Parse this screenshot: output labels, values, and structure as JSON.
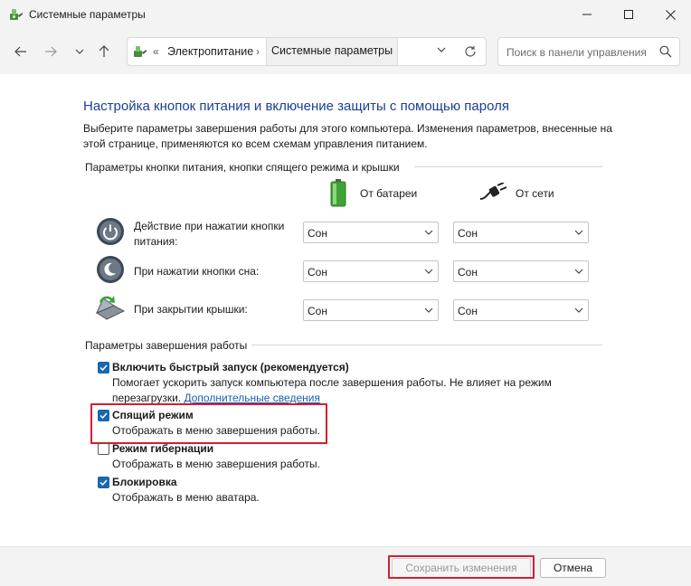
{
  "window": {
    "title": "Системные параметры",
    "app_icon": "power-options-icon",
    "controls": [
      "minimize-icon",
      "maximize-icon",
      "close-icon"
    ]
  },
  "nav": {
    "back_icon": "arrow-left-icon",
    "forward_icon": "arrow-right-icon",
    "history_icon": "chevron-down-icon",
    "up_icon": "arrow-up-icon",
    "breadcrumb": {
      "overflow": "«",
      "items": [
        "Электропитание",
        "Системные параметры"
      ],
      "separator": "›"
    },
    "refresh_icon": "refresh-icon",
    "search_placeholder": "Поиск в панели управления",
    "search_icon": "search-icon"
  },
  "page": {
    "title": "Настройка кнопок питания и включение защиты с помощью пароля",
    "intro": "Выберите параметры завершения работы для этого компьютера. Изменения параметров, внесенные на этой странице, применяются ко всем схемам управления питанием.",
    "power_section": {
      "header": "Параметры кнопки питания, кнопки спящего режима и крышки",
      "columns": [
        {
          "label": "От батареи",
          "icon": "battery-icon"
        },
        {
          "label": "От сети",
          "icon": "plug-icon"
        }
      ],
      "rows": [
        {
          "label": "Действие при нажатии кнопки питания:",
          "icon": "power-button-icon",
          "battery": "Сон",
          "ac": "Сон"
        },
        {
          "label": "При нажатии кнопки сна:",
          "icon": "sleep-button-icon",
          "battery": "Сон",
          "ac": "Сон"
        },
        {
          "label": "При закрытии крышки:",
          "icon": "laptop-lid-icon",
          "battery": "Сон",
          "ac": "Сон"
        }
      ]
    },
    "shutdown_section": {
      "header": "Параметры завершения работы",
      "options": [
        {
          "title": "Включить быстрый запуск (рекомендуется)",
          "checked": true,
          "desc": "Помогает ускорить запуск компьютера после завершения работы. Не влияет на режим перезагрузки.",
          "link": "Дополнительные сведения"
        },
        {
          "title": "Спящий режим",
          "checked": true,
          "desc": "Отображать в меню завершения работы."
        },
        {
          "title": "Режим гибернации",
          "checked": false,
          "desc": "Отображать в меню завершения работы."
        },
        {
          "title": "Блокировка",
          "checked": true,
          "desc": "Отображать в меню аватара."
        }
      ]
    }
  },
  "footer": {
    "save_label": "Сохранить изменения",
    "cancel_label": "Отмена"
  },
  "colors": {
    "title_blue": "#1c3f94",
    "checkbox_blue": "#1966b3",
    "highlight_red": "#d41f2d",
    "link_blue": "#1a5fb4"
  }
}
